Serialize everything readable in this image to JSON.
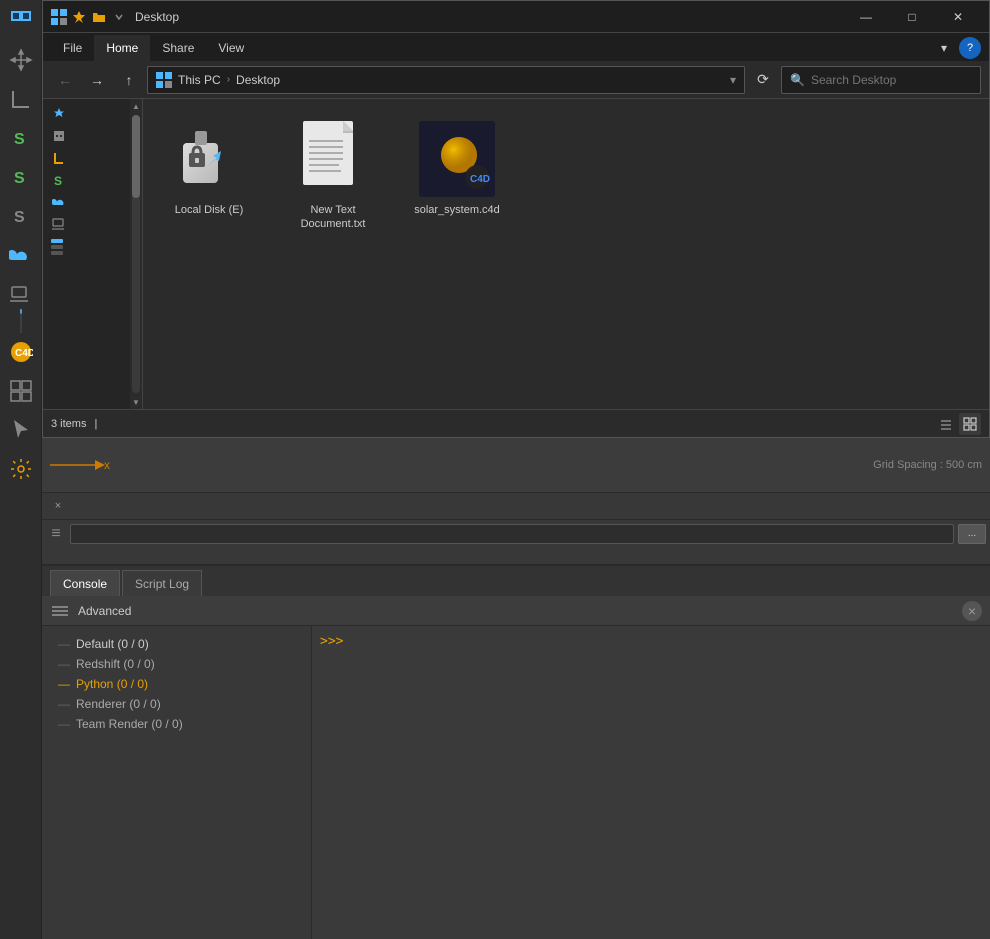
{
  "sidebar": {
    "tools": [
      {
        "name": "undo-icon",
        "symbol": "↩"
      },
      {
        "name": "move-icon",
        "symbol": "✛"
      },
      {
        "name": "scale-icon",
        "symbol": "⊞"
      },
      {
        "name": "rotate-icon",
        "symbol": "↺"
      },
      {
        "name": "cube-icon",
        "symbol": "□"
      },
      {
        "name": "s-icon-1",
        "symbol": "S"
      },
      {
        "name": "s-icon-2",
        "symbol": "S"
      },
      {
        "name": "s-icon-3",
        "symbol": "S"
      },
      {
        "name": "cloud-icon",
        "symbol": "☁"
      },
      {
        "name": "laptop-icon",
        "symbol": "⬜"
      },
      {
        "name": "bend-icon",
        "symbol": "⌐"
      },
      {
        "name": "c4d-logo",
        "symbol": "🔧"
      },
      {
        "name": "grid-icon",
        "symbol": "⊞"
      },
      {
        "name": "cursor-icon",
        "symbol": "↖"
      },
      {
        "name": "settings-icon",
        "symbol": "⚙"
      }
    ]
  },
  "titlebar": {
    "title": "Desktop",
    "icons": [
      "minimize",
      "maximize",
      "close"
    ]
  },
  "ribbon": {
    "tabs": [
      "File",
      "Home",
      "Share",
      "View"
    ],
    "active_tab": "Home",
    "chevron": "▾",
    "help": "?"
  },
  "addressbar": {
    "back_tooltip": "Back",
    "forward_tooltip": "Forward",
    "up_tooltip": "Up",
    "path_parts": [
      "This PC",
      "Desktop"
    ],
    "refresh_tooltip": "Refresh",
    "search_placeholder": "Search Desktop"
  },
  "quick_access": {
    "items": [
      {
        "label": "★",
        "name": "quick-star"
      },
      {
        "label": "🏢",
        "name": "quick-building"
      },
      {
        "label": "📐",
        "name": "quick-tools"
      },
      {
        "label": "S",
        "name": "quick-s"
      },
      {
        "label": "☁",
        "name": "quick-cloud"
      },
      {
        "label": "💻",
        "name": "quick-laptop"
      },
      {
        "label": "▌",
        "name": "quick-bar1"
      },
      {
        "label": "▌",
        "name": "quick-bar2"
      },
      {
        "label": "▌",
        "name": "quick-bar3"
      }
    ]
  },
  "files": [
    {
      "name": "local-disk-file",
      "label": "Local Disk (E)",
      "type": "usb-drive"
    },
    {
      "name": "new-text-file",
      "label": "New Text Document.txt",
      "type": "text-file"
    },
    {
      "name": "solar-system-file",
      "label": "solar_system.c4d",
      "type": "c4d-file"
    }
  ],
  "statusbar": {
    "item_count": "3 items",
    "separator": "|"
  },
  "viewport": {
    "grid_spacing": "Grid Spacing : 500 cm",
    "x_axis": "x"
  },
  "timeline": {
    "close_label": "×",
    "dots_label": "...",
    "hamburger": "≡"
  },
  "console": {
    "tabs": [
      {
        "label": "Console",
        "active": true
      },
      {
        "label": "Script Log",
        "active": false
      }
    ],
    "header_title": "Advanced",
    "close_label": "×",
    "tree_items": [
      {
        "label": "Default (0 / 0)",
        "class": "default"
      },
      {
        "label": "Redshift (0 / 0)",
        "class": "normal"
      },
      {
        "label": "Python (0 / 0)",
        "class": "python"
      },
      {
        "label": "Renderer (0 / 0)",
        "class": "normal"
      },
      {
        "label": "Team Render  (0 / 0)",
        "class": "normal"
      }
    ],
    "prompt": ">>>"
  }
}
